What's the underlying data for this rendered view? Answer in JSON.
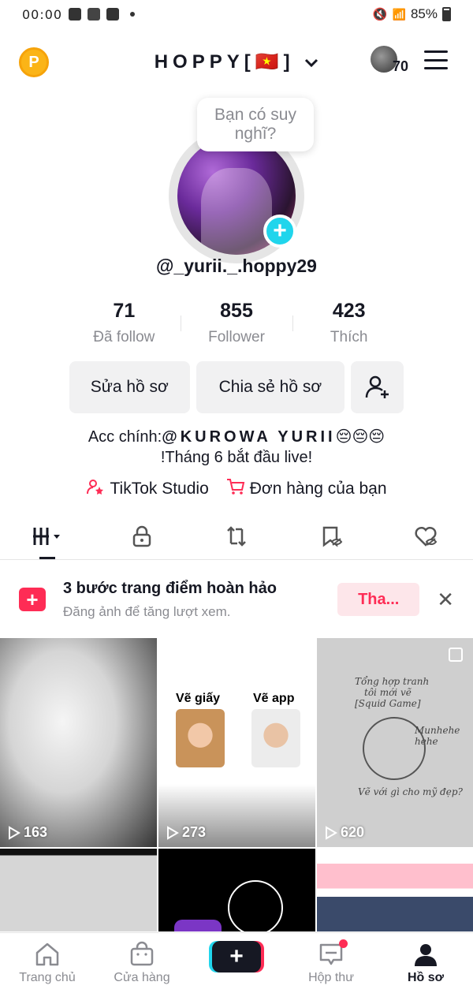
{
  "status_bar": {
    "time": "00:00",
    "battery": "85%"
  },
  "header": {
    "coin_label": "P",
    "brand": "HOPPY[🇻🇳]",
    "chevron": "⌄",
    "badge_count": "70"
  },
  "profile": {
    "bubble_text": "Bạn có suy nghĩ?",
    "add_symbol": "+",
    "username": "@_yurii._.hoppy29",
    "stats": [
      {
        "value": "71",
        "label": "Đã follow"
      },
      {
        "value": "855",
        "label": "Follower"
      },
      {
        "value": "423",
        "label": "Thích"
      }
    ],
    "buttons": {
      "edit": "Sửa hồ sơ",
      "share": "Chia sẻ hồ sơ"
    },
    "bio_prefix": "Acc chính:",
    "bio_handle": "@KUROWA  YURII",
    "bio_emoji": "😔😔😔",
    "bio_line2": "!Tháng 6 bắt đầu live!",
    "links": [
      {
        "label": "TikTok Studio",
        "icon": "person-star-icon"
      },
      {
        "label": "Đơn hàng của bạn",
        "icon": "cart-icon"
      }
    ]
  },
  "tabs": [
    {
      "name": "videos-grid",
      "icon": "grid-icon",
      "active": true
    },
    {
      "name": "private",
      "icon": "lock-icon",
      "active": false
    },
    {
      "name": "reposts",
      "icon": "repost-icon",
      "active": false
    },
    {
      "name": "favorites",
      "icon": "bookmark-hidden-icon",
      "active": false
    },
    {
      "name": "liked",
      "icon": "heart-hidden-icon",
      "active": false
    }
  ],
  "banner": {
    "title": "3 bước trang điểm hoàn hảo",
    "subtitle": "Đăng ảnh để tăng lượt xem.",
    "button": "Tha...",
    "close": "✕"
  },
  "videos": [
    {
      "views": "163"
    },
    {
      "views": "273",
      "label_left": "Vẽ giấy",
      "label_right": "Vẽ app"
    },
    {
      "views": "620",
      "note_lines": [
        "Tổng hợp tranh",
        "tôi mới vẽ",
        "[Squid Game]"
      ],
      "note_side": "Munhehe hehe",
      "note_bottom": "Vẽ với gì cho mỹ đẹp?"
    }
  ],
  "bottom_nav": [
    {
      "label": "Trang chủ",
      "icon": "home-icon"
    },
    {
      "label": "Cửa hàng",
      "icon": "shop-bag-icon"
    },
    {
      "label": "",
      "icon": "create-plus-icon"
    },
    {
      "label": "Hộp thư",
      "icon": "inbox-icon"
    },
    {
      "label": "Hồ sơ",
      "icon": "profile-icon"
    }
  ],
  "colors": {
    "accent_red": "#fe2c55",
    "accent_cyan": "#20d5ec",
    "text_dark": "#161823",
    "text_gray": "#8a8b91"
  }
}
